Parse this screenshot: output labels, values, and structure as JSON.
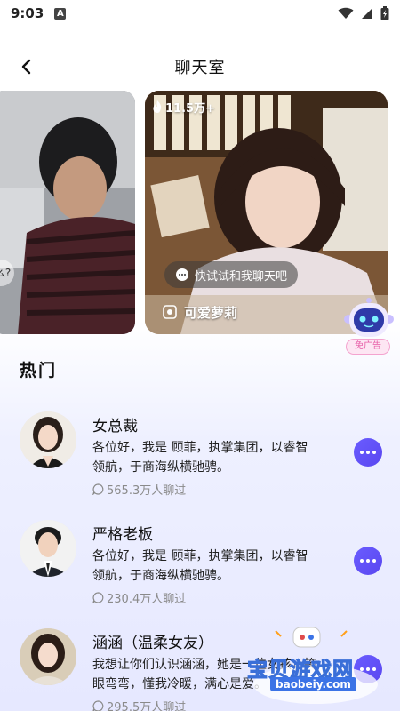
{
  "status_bar": {
    "time": "9:03",
    "notification_icon": "A"
  },
  "header": {
    "title": "聊天室"
  },
  "carousel": {
    "left_card": {
      "bubble_text": "么?"
    },
    "main_card": {
      "heat": "11.5万+",
      "bubble_text": "快试试和我聊天吧",
      "name": "可爱萝莉"
    }
  },
  "ad": {
    "label": "免广告"
  },
  "section": {
    "title": "热门"
  },
  "items": [
    {
      "name": "女总裁",
      "desc": "各位好，我是 顾菲，执掌集团，以睿智领航，于商海纵横驰骋。",
      "count": "565.3万人聊过"
    },
    {
      "name": "严格老板",
      "desc": "各位好，我是 顾菲，执掌集团，以睿智领航，于商海纵横驰骋。",
      "count": "230.4万人聊过"
    },
    {
      "name": "涵涵（温柔女友）",
      "desc": "我想让你们认识涵涵，她是一位女孩，笑眼弯弯，懂我冷暖，满心是爱。",
      "count": "295.5万人聊过"
    }
  ],
  "watermark": {
    "text": "宝贝游戏网",
    "url": "baobeiy.com"
  },
  "colors": {
    "accent": "#5a47f0",
    "count_gray": "#8a8a8a"
  }
}
